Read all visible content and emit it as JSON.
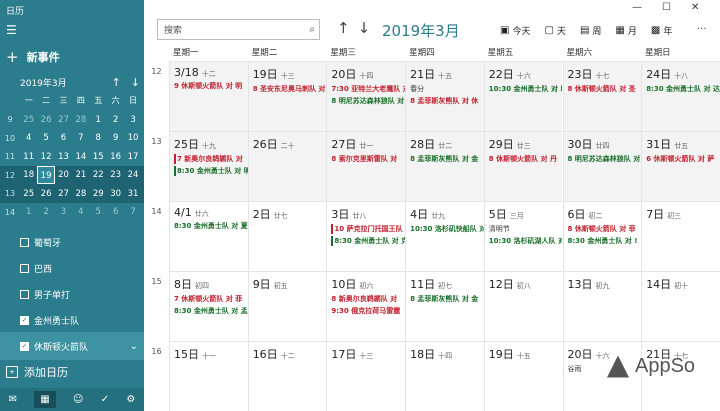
{
  "app_title": "日历",
  "new_event": "新事件",
  "mini": {
    "title": "2019年3月",
    "weekdays": [
      "一",
      "二",
      "三",
      "四",
      "五",
      "六",
      "日"
    ],
    "rows": [
      {
        "wk": "9",
        "days": [
          "25",
          "26",
          "27",
          "28",
          "1",
          "2",
          "3"
        ]
      },
      {
        "wk": "10",
        "days": [
          "4",
          "5",
          "6",
          "7",
          "8",
          "9",
          "10"
        ]
      },
      {
        "wk": "11",
        "days": [
          "11",
          "12",
          "13",
          "14",
          "15",
          "16",
          "17"
        ]
      },
      {
        "wk": "12",
        "days": [
          "18",
          "19",
          "20",
          "21",
          "22",
          "23",
          "24"
        ]
      },
      {
        "wk": "13",
        "days": [
          "25",
          "26",
          "27",
          "28",
          "29",
          "30",
          "31"
        ]
      },
      {
        "wk": "14",
        "days": [
          "1",
          "2",
          "3",
          "4",
          "5",
          "6",
          "7"
        ]
      }
    ]
  },
  "calendars": [
    {
      "label": "葡萄牙",
      "checked": false
    },
    {
      "label": "巴西",
      "checked": false
    },
    {
      "label": "男子单打",
      "checked": false
    },
    {
      "label": "金州勇士队",
      "checked": true
    },
    {
      "label": "休斯顿火箭队",
      "checked": true
    }
  ],
  "add_calendar": "添加日历",
  "search_placeholder": "搜索",
  "month_title": "2019年3月",
  "views": [
    "今天",
    "天",
    "周",
    "月",
    "年"
  ],
  "weekday_headers": [
    "星期一",
    "星期二",
    "星期三",
    "星期四",
    "星期五",
    "星期六",
    "星期日"
  ],
  "weeks": [
    {
      "num": "12",
      "days": [
        {
          "d": "3/18",
          "l": "十二",
          "events": [
            {
              "t": "9 休斯顿火箭队 对 明",
              "c": "r"
            }
          ]
        },
        {
          "d": "19日",
          "l": "十三",
          "events": [
            {
              "t": "8 圣安东尼奥马刺队 对",
              "c": "r"
            }
          ]
        },
        {
          "d": "20日",
          "l": "十四",
          "events": [
            {
              "t": "7:30 亚特兰大老鹰队 对",
              "c": "r"
            },
            {
              "t": "8 明尼苏达森林狼队 对",
              "c": "g"
            }
          ]
        },
        {
          "d": "21日",
          "l": "十五",
          "holiday": "春分",
          "events": [
            {
              "t": "8 孟菲斯灰熊队 对 休",
              "c": "r"
            }
          ]
        },
        {
          "d": "22日",
          "l": "十六",
          "events": [
            {
              "t": "10:30 金州勇士队 对 印",
              "c": "g"
            }
          ]
        },
        {
          "d": "23日",
          "l": "十七",
          "events": [
            {
              "t": "8 休斯顿火箭队 对 圣",
              "c": "r"
            }
          ]
        },
        {
          "d": "24日",
          "l": "十八",
          "events": [
            {
              "t": "8:30 金州勇士队 对 达",
              "c": "g"
            }
          ]
        }
      ]
    },
    {
      "num": "13",
      "days": [
        {
          "d": "25日",
          "l": "十九",
          "events": [
            {
              "t": "7 新奥尔良鹈鹕队 对",
              "c": "r"
            },
            {
              "t": "8:30 金州勇士队 对 明",
              "c": "g"
            }
          ]
        },
        {
          "d": "26日",
          "l": "二十",
          "events": []
        },
        {
          "d": "27日",
          "l": "廿一",
          "events": [
            {
              "t": "8 索尔克里斯雷队 对",
              "c": "r"
            }
          ]
        },
        {
          "d": "28日",
          "l": "廿二",
          "events": [
            {
              "t": "8 孟菲斯灰熊队 对 金",
              "c": "g"
            }
          ]
        },
        {
          "d": "29日",
          "l": "廿三",
          "events": [
            {
              "t": "8 休斯顿火箭队 对 丹",
              "c": "r"
            }
          ]
        },
        {
          "d": "30日",
          "l": "廿四",
          "events": [
            {
              "t": "8 明尼苏达森林狼队 对",
              "c": "g"
            }
          ]
        },
        {
          "d": "31日",
          "l": "廿五",
          "events": [
            {
              "t": "6 休斯顿火箭队 对 萨",
              "c": "r"
            }
          ]
        }
      ]
    },
    {
      "num": "14",
      "days": [
        {
          "d": "4/1",
          "l": "廿六",
          "events": [
            {
              "t": "8:30 金州勇士队 对 夏",
              "c": "g"
            }
          ]
        },
        {
          "d": "2日",
          "l": "廿七",
          "events": []
        },
        {
          "d": "3日",
          "l": "廿八",
          "events": [
            {
              "t": "10 萨克拉门托国王队",
              "c": "r"
            },
            {
              "t": "8:30 金州勇士队 对 克",
              "c": "g"
            }
          ]
        },
        {
          "d": "4日",
          "l": "廿九",
          "events": [
            {
              "t": "10:30 洛杉矶快船队 对",
              "c": "g"
            }
          ]
        },
        {
          "d": "5日",
          "l": "三月",
          "holiday": "清明节",
          "events": [
            {
              "t": "10:30 洛杉矶湖人队 对",
              "c": "g"
            }
          ]
        },
        {
          "d": "6日",
          "l": "初二",
          "events": [
            {
              "t": "8 休斯顿火箭队 对 菲",
              "c": "r"
            },
            {
              "t": "8:30 金州勇士队 对 !",
              "c": "g"
            }
          ]
        },
        {
          "d": "7日",
          "l": "初三",
          "events": []
        }
      ]
    },
    {
      "num": "15",
      "days": [
        {
          "d": "8日",
          "l": "初四",
          "events": [
            {
              "t": "7 休斯顿火箭队 对 菲",
              "c": "r"
            },
            {
              "t": "8:30 金州勇士队 对 孟",
              "c": "g"
            }
          ]
        },
        {
          "d": "9日",
          "l": "初五",
          "events": []
        },
        {
          "d": "10日",
          "l": "初六",
          "events": [
            {
              "t": "8 新奥尔良鹈鹕队 对",
              "c": "r"
            },
            {
              "t": "9:30 俄克拉荷马雷霆",
              "c": "r"
            }
          ]
        },
        {
          "d": "11日",
          "l": "初七",
          "events": [
            {
              "t": "8 孟菲斯灰熊队 对 金",
              "c": "g"
            }
          ]
        },
        {
          "d": "12日",
          "l": "初八",
          "events": []
        },
        {
          "d": "13日",
          "l": "初九",
          "events": []
        },
        {
          "d": "14日",
          "l": "初十",
          "events": []
        }
      ]
    },
    {
      "num": "16",
      "days": [
        {
          "d": "15日",
          "l": "十一",
          "events": []
        },
        {
          "d": "16日",
          "l": "十二",
          "events": []
        },
        {
          "d": "17日",
          "l": "十三",
          "events": []
        },
        {
          "d": "18日",
          "l": "十四",
          "events": []
        },
        {
          "d": "19日",
          "l": "十五",
          "events": []
        },
        {
          "d": "20日",
          "l": "十六",
          "holiday": "谷雨",
          "events": []
        },
        {
          "d": "21日",
          "l": "十七",
          "events": []
        }
      ]
    }
  ],
  "watermark": "AppSo",
  "colors": {
    "accent": "#2b7c8c",
    "rockets": "#c0202f",
    "warriors": "#1a6f2a"
  }
}
